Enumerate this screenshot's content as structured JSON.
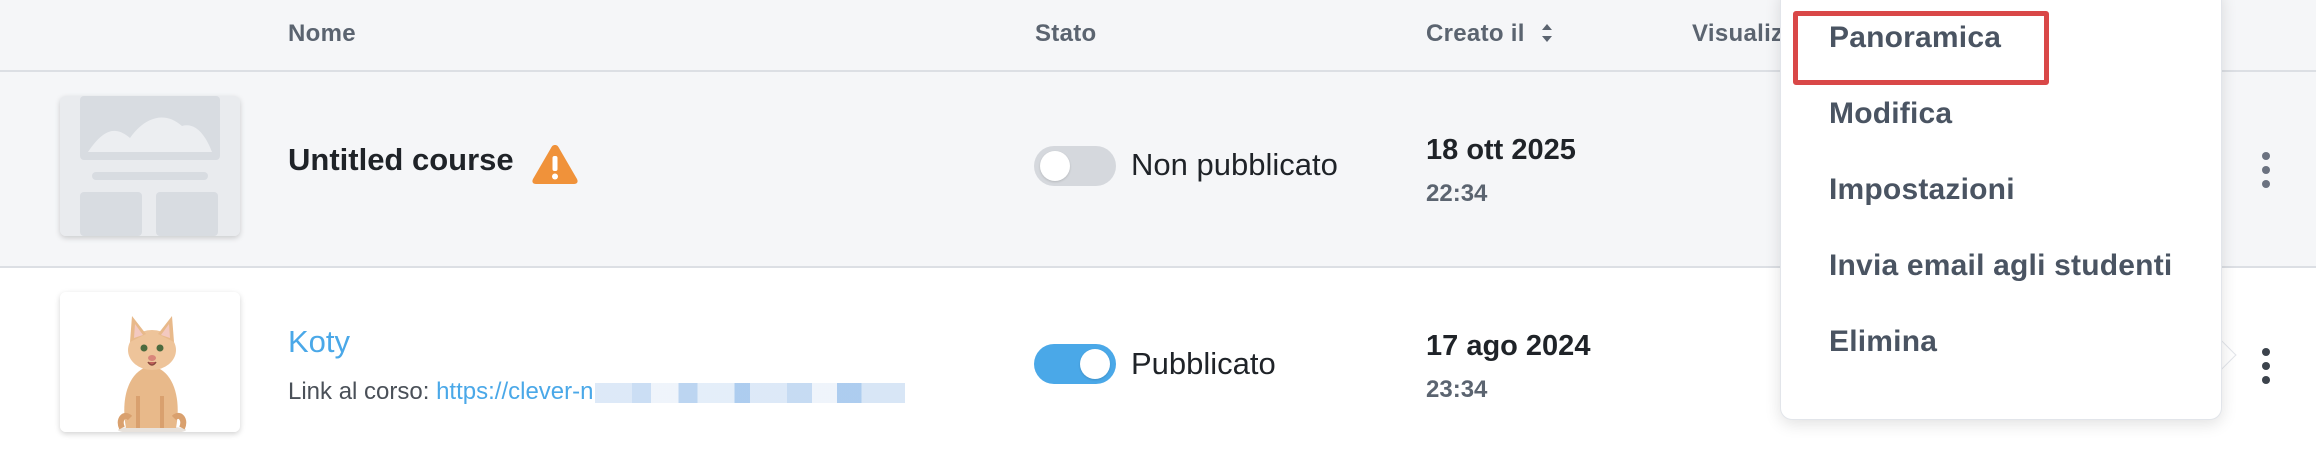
{
  "table": {
    "columns": {
      "name": "Nome",
      "status": "Stato",
      "created": "Creato il",
      "views": "Visualiz"
    }
  },
  "courses": [
    {
      "title": "Untitled course",
      "status": "Non pubblicato",
      "published": false,
      "date": "18 ott 2025",
      "time": "22:34",
      "has_warning": true
    },
    {
      "title": "Koty",
      "status": "Pubblicato",
      "published": true,
      "date": "17 ago 2024",
      "time": "23:34",
      "link_label": "Link al corso: ",
      "link_url": "https://clever-n"
    }
  ],
  "menu": {
    "items": [
      "Panoramica",
      "Modifica",
      "Impostazioni",
      "Invia email agli studenti",
      "Elimina"
    ],
    "highlighted": "Panoramica"
  },
  "colors": {
    "accent": "#4aa8e8",
    "warning": "#f0923a",
    "highlight_border": "#d94848"
  },
  "icons": {
    "sort": "sort-icon",
    "warning": "warning-icon",
    "more": "more-vertical-icon",
    "placeholder": "course-placeholder-image",
    "thumbnail": "cat-thumbnail"
  }
}
